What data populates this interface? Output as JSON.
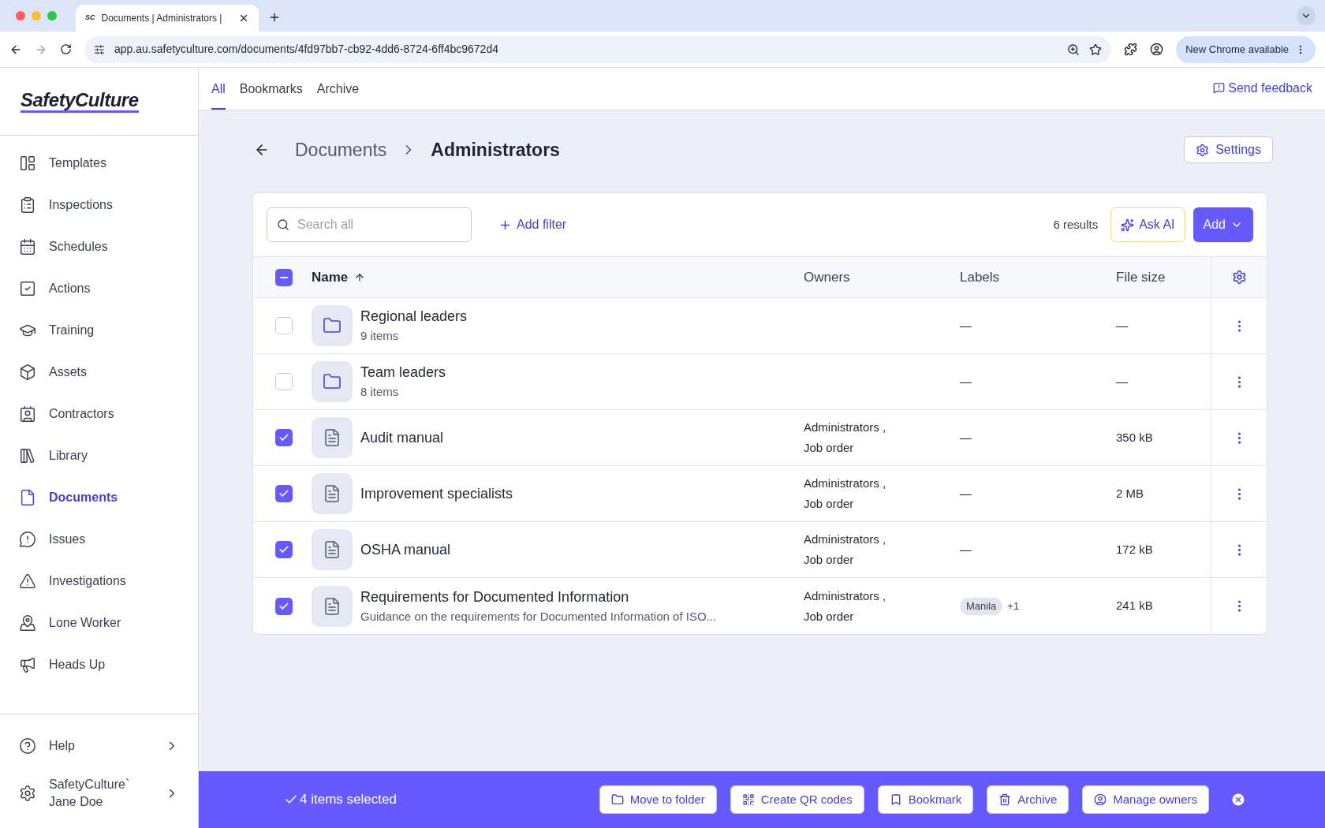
{
  "browser": {
    "favicon": "SC",
    "tab_title": "Documents | Administrators |",
    "url": "app.au.safetyculture.com/documents/4fd97bb7-cb92-4dd6-8724-6ff4bc9672d4",
    "update_button": "New Chrome available"
  },
  "sidebar": {
    "logo": "SafetyCulture",
    "items": [
      {
        "label": "Templates",
        "selected": false
      },
      {
        "label": "Inspections",
        "selected": false
      },
      {
        "label": "Schedules",
        "selected": false
      },
      {
        "label": "Actions",
        "selected": false
      },
      {
        "label": "Training",
        "selected": false
      },
      {
        "label": "Assets",
        "selected": false
      },
      {
        "label": "Contractors",
        "selected": false
      },
      {
        "label": "Library",
        "selected": false
      },
      {
        "label": "Documents",
        "selected": true
      },
      {
        "label": "Issues",
        "selected": false
      },
      {
        "label": "Investigations",
        "selected": false
      },
      {
        "label": "Lone Worker",
        "selected": false
      },
      {
        "label": "Heads Up",
        "selected": false
      }
    ],
    "help": "Help",
    "account": {
      "org": "SafetyCulture`",
      "user": "Jane Doe"
    }
  },
  "tabs": [
    {
      "label": "All",
      "selected": true
    },
    {
      "label": "Bookmarks",
      "selected": false
    },
    {
      "label": "Archive",
      "selected": false
    }
  ],
  "send_feedback": "Send feedback",
  "breadcrumb": [
    "Documents",
    "Administrators"
  ],
  "settings_button": "Settings",
  "toolbar": {
    "search_placeholder": "Search all",
    "add_filter": "Add filter",
    "results": "6 results",
    "ask_ai": "Ask AI",
    "add": "Add"
  },
  "table": {
    "header_indeterminate": true,
    "columns": [
      "Name",
      "Owners",
      "Labels",
      "File size"
    ],
    "rows": [
      {
        "kind": "folder",
        "selected": false,
        "name": "Regional leaders",
        "subtitle": "9 items",
        "owners": [],
        "labels_text": "—",
        "size": "—"
      },
      {
        "kind": "folder",
        "selected": false,
        "name": "Team leaders",
        "subtitle": "8 items",
        "owners": [],
        "labels_text": "—",
        "size": "—"
      },
      {
        "kind": "pdf",
        "selected": true,
        "name": "Audit manual",
        "owners": [
          "Administrators ,",
          "Job order"
        ],
        "labels_text": "—",
        "size": "350 kB"
      },
      {
        "kind": "pdf",
        "selected": true,
        "name": "Improvement specialists",
        "owners": [
          "Administrators ,",
          "Job order"
        ],
        "labels_text": "—",
        "size": "2 MB"
      },
      {
        "kind": "pdf",
        "selected": true,
        "name": "OSHA manual",
        "owners": [
          "Administrators ,",
          "Job order"
        ],
        "labels_text": "—",
        "size": "172 kB"
      },
      {
        "kind": "pdf",
        "selected": true,
        "name": "Requirements for Documented Information",
        "subtitle": "Guidance on the requirements for Documented Information of ISO...",
        "owners": [
          "Administrators ,",
          "Job order"
        ],
        "tags": [
          "Manila"
        ],
        "tags_more": "+1",
        "size": "241 kB"
      }
    ]
  },
  "selection_bar": {
    "text": "4 items selected",
    "actions": [
      {
        "kind": "folder",
        "label": "Move to folder"
      },
      {
        "kind": "qr",
        "label": "Create QR codes"
      },
      {
        "kind": "bookmark",
        "label": "Bookmark"
      },
      {
        "kind": "archive",
        "label": "Archive"
      },
      {
        "kind": "owners",
        "label": "Manage owners"
      }
    ]
  }
}
